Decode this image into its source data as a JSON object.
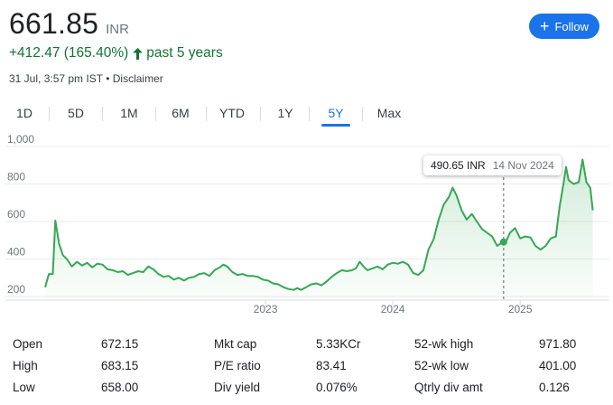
{
  "quote": {
    "price": "661.85",
    "currency": "INR",
    "change": "+412.47 (165.40%)",
    "period": "past 5 years",
    "timestamp": "31 Jul, 3:57 pm IST",
    "separator": "•",
    "disclaimer": "Disclaimer",
    "trend_color": "#137333"
  },
  "follow_button": {
    "label": "Follow",
    "color": "#1a73e8"
  },
  "range_tabs": [
    {
      "label": "1D",
      "active": false
    },
    {
      "label": "5D",
      "active": false
    },
    {
      "label": "1M",
      "active": false
    },
    {
      "label": "6M",
      "active": false
    },
    {
      "label": "YTD",
      "active": false
    },
    {
      "label": "1Y",
      "active": false
    },
    {
      "label": "5Y",
      "active": true
    },
    {
      "label": "Max",
      "active": false
    }
  ],
  "tooltip": {
    "price": "490.65 INR",
    "date": "14 Nov 2024"
  },
  "chart_data": {
    "type": "area",
    "y_ticks": [
      "1,000",
      "800",
      "600",
      "400",
      "200"
    ],
    "ylim": [
      200,
      1000
    ],
    "x_ticks": [
      {
        "label": "2023",
        "x": 2023.0
      },
      {
        "label": "2024",
        "x": 2024.0
      },
      {
        "label": "2025",
        "x": 2025.0
      }
    ],
    "xlim": [
      2021.27,
      2025.58
    ],
    "line_color": "#34a853",
    "hover_x": 2024.87,
    "series": [
      {
        "points": [
          [
            2021.27,
            250
          ],
          [
            2021.3,
            320
          ],
          [
            2021.33,
            320
          ],
          [
            2021.35,
            605
          ],
          [
            2021.38,
            480
          ],
          [
            2021.41,
            420
          ],
          [
            2021.44,
            400
          ],
          [
            2021.48,
            360
          ],
          [
            2021.52,
            385
          ],
          [
            2021.56,
            365
          ],
          [
            2021.6,
            380
          ],
          [
            2021.64,
            355
          ],
          [
            2021.68,
            375
          ],
          [
            2021.72,
            370
          ],
          [
            2021.76,
            345
          ],
          [
            2021.8,
            340
          ],
          [
            2021.84,
            330
          ],
          [
            2021.88,
            335
          ],
          [
            2021.92,
            315
          ],
          [
            2021.96,
            325
          ],
          [
            2022.0,
            335
          ],
          [
            2022.04,
            330
          ],
          [
            2022.08,
            360
          ],
          [
            2022.12,
            345
          ],
          [
            2022.16,
            320
          ],
          [
            2022.2,
            305
          ],
          [
            2022.24,
            310
          ],
          [
            2022.28,
            290
          ],
          [
            2022.32,
            300
          ],
          [
            2022.36,
            285
          ],
          [
            2022.4,
            300
          ],
          [
            2022.44,
            305
          ],
          [
            2022.48,
            320
          ],
          [
            2022.52,
            325
          ],
          [
            2022.56,
            310
          ],
          [
            2022.6,
            340
          ],
          [
            2022.64,
            355
          ],
          [
            2022.67,
            370
          ],
          [
            2022.7,
            360
          ],
          [
            2022.74,
            330
          ],
          [
            2022.78,
            315
          ],
          [
            2022.82,
            320
          ],
          [
            2022.86,
            310
          ],
          [
            2022.9,
            310
          ],
          [
            2022.94,
            305
          ],
          [
            2022.98,
            290
          ],
          [
            2023.02,
            285
          ],
          [
            2023.06,
            270
          ],
          [
            2023.1,
            265
          ],
          [
            2023.14,
            250
          ],
          [
            2023.18,
            240
          ],
          [
            2023.22,
            235
          ],
          [
            2023.25,
            245
          ],
          [
            2023.28,
            235
          ],
          [
            2023.32,
            250
          ],
          [
            2023.36,
            265
          ],
          [
            2023.4,
            270
          ],
          [
            2023.44,
            260
          ],
          [
            2023.48,
            280
          ],
          [
            2023.52,
            305
          ],
          [
            2023.56,
            325
          ],
          [
            2023.6,
            340
          ],
          [
            2023.64,
            335
          ],
          [
            2023.68,
            340
          ],
          [
            2023.71,
            350
          ],
          [
            2023.74,
            385
          ],
          [
            2023.77,
            360
          ],
          [
            2023.8,
            340
          ],
          [
            2023.84,
            350
          ],
          [
            2023.88,
            360
          ],
          [
            2023.92,
            345
          ],
          [
            2023.96,
            370
          ],
          [
            2024.0,
            380
          ],
          [
            2024.04,
            375
          ],
          [
            2024.08,
            385
          ],
          [
            2024.12,
            370
          ],
          [
            2024.16,
            325
          ],
          [
            2024.2,
            315
          ],
          [
            2024.24,
            340
          ],
          [
            2024.28,
            450
          ],
          [
            2024.32,
            505
          ],
          [
            2024.36,
            610
          ],
          [
            2024.4,
            690
          ],
          [
            2024.44,
            730
          ],
          [
            2024.47,
            780
          ],
          [
            2024.5,
            740
          ],
          [
            2024.54,
            660
          ],
          [
            2024.58,
            610
          ],
          [
            2024.62,
            640
          ],
          [
            2024.66,
            600
          ],
          [
            2024.7,
            560
          ],
          [
            2024.74,
            540
          ],
          [
            2024.78,
            520
          ],
          [
            2024.82,
            470
          ],
          [
            2024.86,
            490
          ],
          [
            2024.88,
            480
          ],
          [
            2024.92,
            540
          ],
          [
            2024.96,
            565
          ],
          [
            2025.0,
            510
          ],
          [
            2025.04,
            520
          ],
          [
            2025.08,
            515
          ],
          [
            2025.12,
            470
          ],
          [
            2025.16,
            450
          ],
          [
            2025.2,
            470
          ],
          [
            2025.24,
            510
          ],
          [
            2025.28,
            520
          ],
          [
            2025.31,
            680
          ],
          [
            2025.34,
            800
          ],
          [
            2025.36,
            890
          ],
          [
            2025.38,
            820
          ],
          [
            2025.42,
            800
          ],
          [
            2025.46,
            810
          ],
          [
            2025.49,
            930
          ],
          [
            2025.52,
            810
          ],
          [
            2025.55,
            780
          ],
          [
            2025.57,
            660
          ]
        ]
      }
    ]
  },
  "stats": {
    "col1": [
      {
        "label": "Open",
        "value": "672.15"
      },
      {
        "label": "High",
        "value": "683.15"
      },
      {
        "label": "Low",
        "value": "658.00"
      }
    ],
    "col2": [
      {
        "label": "Mkt cap",
        "value": "5.33KCr"
      },
      {
        "label": "P/E ratio",
        "value": "83.41"
      },
      {
        "label": "Div yield",
        "value": "0.076%"
      }
    ],
    "col3": [
      {
        "label": "52-wk high",
        "value": "971.80"
      },
      {
        "label": "52-wk low",
        "value": "401.00"
      },
      {
        "label": "Qtrly div amt",
        "value": "0.126"
      }
    ]
  }
}
